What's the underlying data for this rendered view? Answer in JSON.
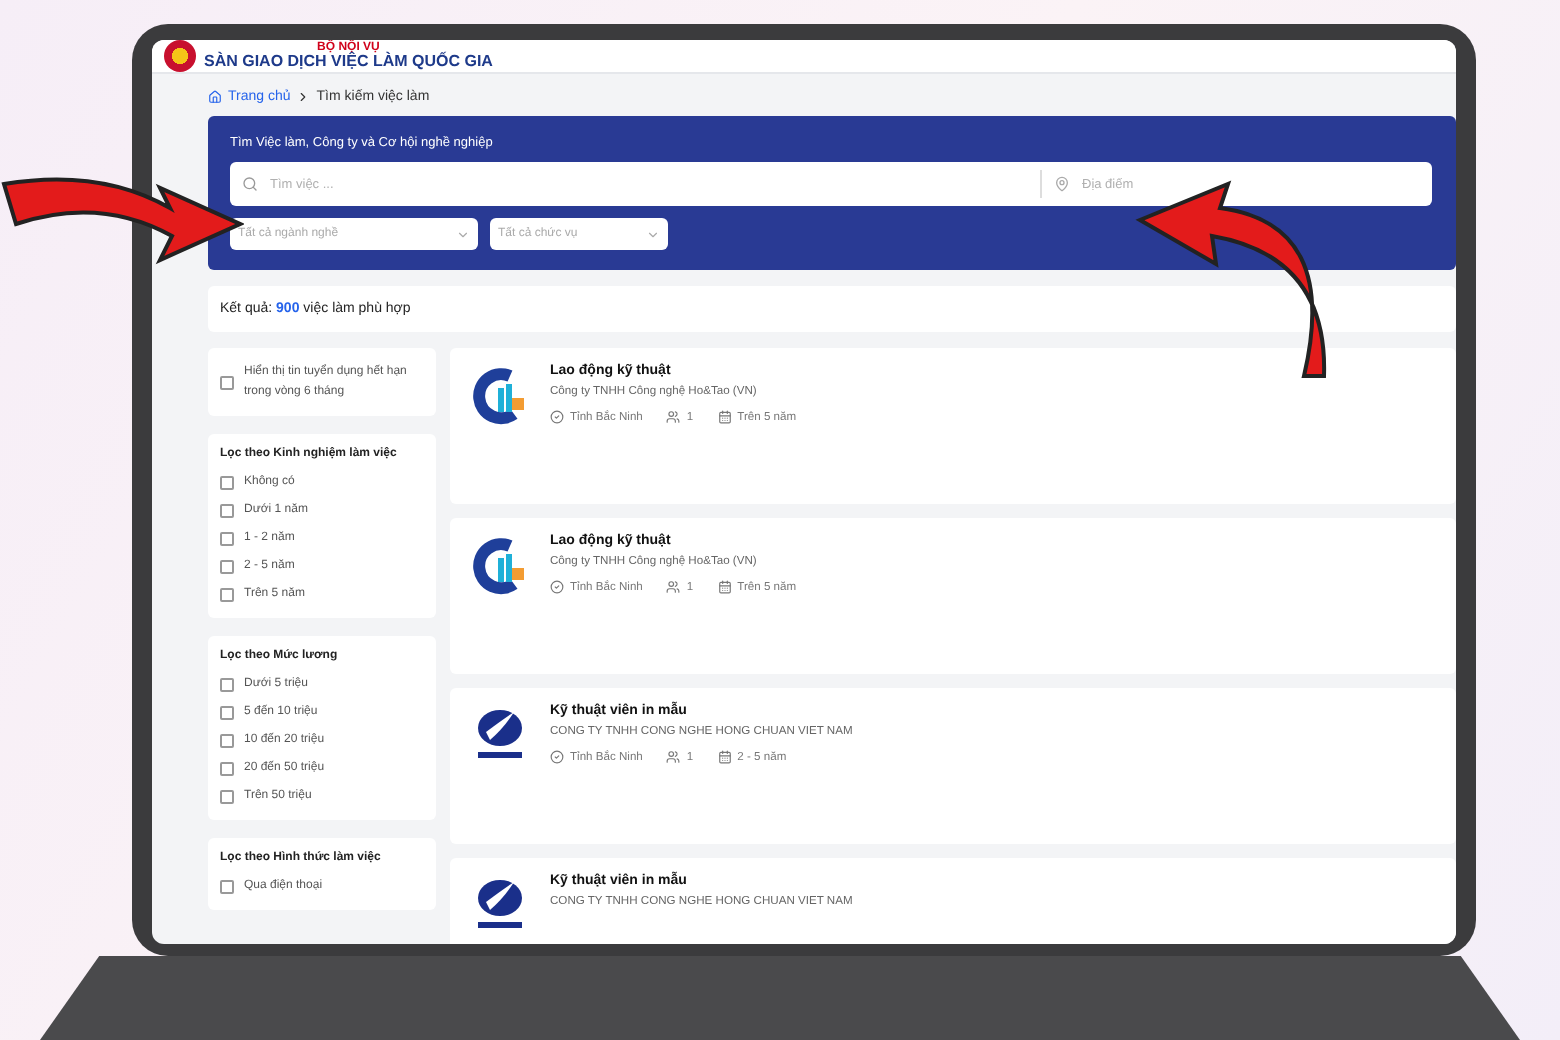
{
  "header": {
    "ministry": "BỘ NỘI VỤ",
    "site_title": "SÀN GIAO DỊCH VIỆC LÀM QUỐC GIA"
  },
  "breadcrumb": [
    {
      "label": "Trang chủ"
    },
    {
      "label": "Tìm kiếm việc làm"
    }
  ],
  "search": {
    "title": "Tìm Việc làm, Công ty và Cơ hội nghề nghiệp",
    "keyword_placeholder": "Tìm việc ...",
    "location_placeholder": "Địa điểm",
    "filters": [
      {
        "placeholder": "Tất cả ngành nghề"
      },
      {
        "placeholder": "Tất cả chức vụ"
      }
    ]
  },
  "results": {
    "prefix": "Kết quả:",
    "count": "900",
    "suffix": "việc làm phù hợp"
  },
  "sidebar": {
    "expired_toggle": {
      "label": "Hiển thị tin tuyển dụng hết hạn trong vòng 6 tháng",
      "checked": false
    },
    "filter_groups": [
      {
        "title": "Lọc theo Kinh nghiệm làm việc",
        "options": [
          {
            "label": "Không có",
            "checked": false
          },
          {
            "label": "Dưới 1 năm",
            "checked": false
          },
          {
            "label": "1 - 2 năm",
            "checked": false
          },
          {
            "label": "2 - 5 năm",
            "checked": false
          },
          {
            "label": "Trên 5 năm",
            "checked": false
          }
        ]
      },
      {
        "title": "Lọc theo Mức lương",
        "options": [
          {
            "label": "Dưới 5 triệu",
            "checked": false
          },
          {
            "label": "5 đến 10 triệu",
            "checked": false
          },
          {
            "label": "10 đến 20 triệu",
            "checked": false
          },
          {
            "label": "20 đến 50 triệu",
            "checked": false
          },
          {
            "label": "Trên 50 triệu",
            "checked": false
          }
        ]
      },
      {
        "title": "Lọc theo Hình thức làm việc",
        "options": [
          {
            "label": "Qua điện thoại",
            "checked": false
          }
        ]
      }
    ]
  },
  "jobs": [
    {
      "kind": "letter-mark",
      "title": "Lao động kỹ thuật",
      "company": "Công ty TNHH Công nghệ Ho&Tao (VN)",
      "location": "Tỉnh Bắc Ninh",
      "openings": "1",
      "experience": "Trên 5 năm"
    },
    {
      "kind": "letter-mark",
      "title": "Lao động kỹ thuật",
      "company": "Công ty TNHH Công nghệ Ho&Tao (VN)",
      "location": "Tỉnh Bắc Ninh",
      "openings": "1",
      "experience": "Trên 5 năm"
    },
    {
      "kind": "bird-mark",
      "title": "Kỹ thuật viên in mẫu",
      "company": "CONG TY TNHH CONG NGHE HONG CHUAN VIET NAM",
      "location": "Tỉnh Bắc Ninh",
      "openings": "1",
      "experience": "2 - 5 năm"
    },
    {
      "kind": "bird-mark",
      "title": "Kỹ thuật viên in mẫu",
      "company": "CONG TY TNHH CONG NGHE HONG CHUAN VIET NAM"
    }
  ]
}
